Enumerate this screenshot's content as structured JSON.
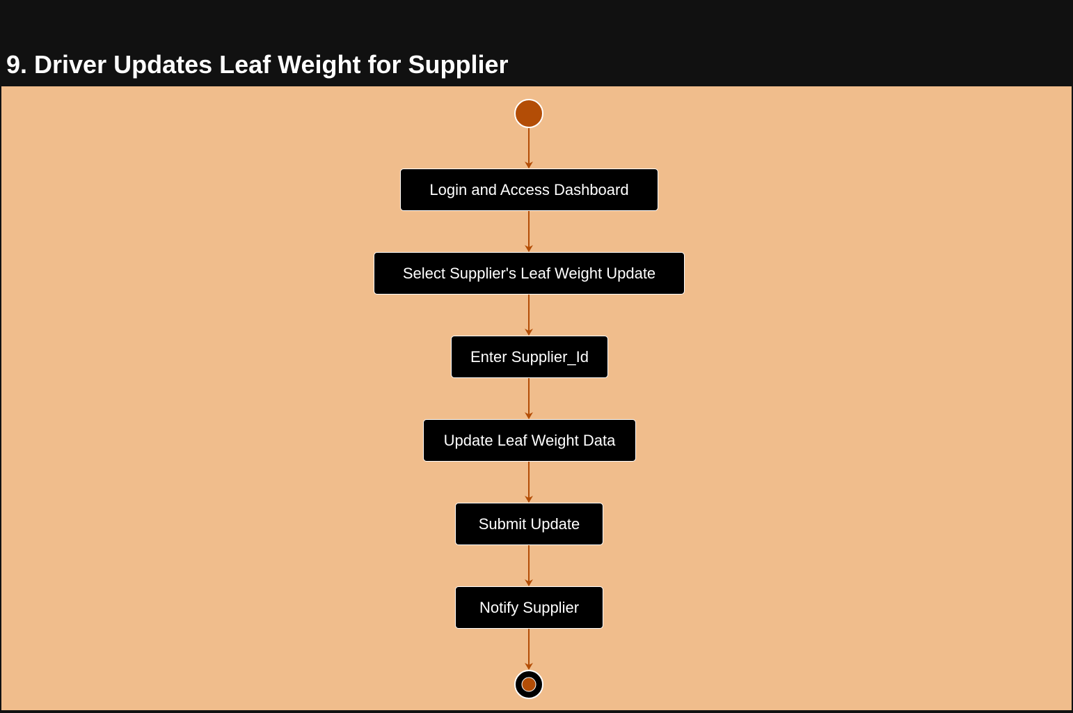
{
  "page": {
    "title": "9. Driver Updates Leaf Weight for Supplier"
  },
  "colors": {
    "background": "#f0bd8c",
    "header": "#111111",
    "node_fill": "#000000",
    "node_text": "#ffffff",
    "accent": "#b34d06"
  },
  "diagram": {
    "type": "activity",
    "start_node": "initial",
    "end_node": "final",
    "actions": [
      {
        "label": "Login and Access Dashboard"
      },
      {
        "label": "Select Supplier's Leaf Weight Update"
      },
      {
        "label": "Enter Supplier_Id"
      },
      {
        "label": "Update Leaf Weight Data"
      },
      {
        "label": "Submit Update"
      },
      {
        "label": "Notify Supplier"
      }
    ]
  }
}
